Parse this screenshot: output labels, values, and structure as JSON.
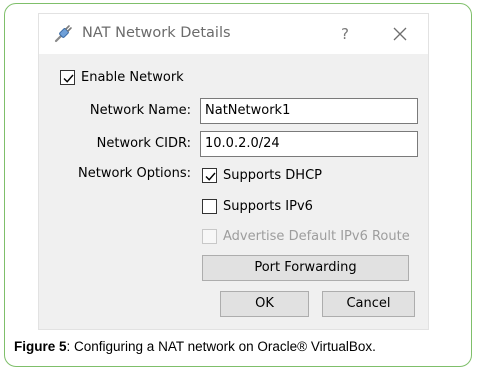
{
  "dialog": {
    "title": "NAT Network Details",
    "help_glyph": "?",
    "icons": {
      "title": "network-cable-icon",
      "close": "close-icon",
      "check": "checkmark-icon"
    }
  },
  "form": {
    "enable_network": {
      "label": "Enable Network",
      "checked": true
    },
    "network_name": {
      "label": "Network Name:",
      "value": "NatNetwork1"
    },
    "network_cidr": {
      "label": "Network CIDR:",
      "value": "10.0.2.0/24"
    },
    "network_options_label": "Network Options:",
    "supports_dhcp": {
      "label": "Supports DHCP",
      "checked": true
    },
    "supports_ipv6": {
      "label": "Supports IPv6",
      "checked": false
    },
    "advertise_ipv6_route": {
      "label": "Advertise Default IPv6 Route",
      "checked": false,
      "enabled": false
    },
    "port_forwarding_label": "Port Forwarding"
  },
  "footer": {
    "ok_label": "OK",
    "cancel_label": "Cancel"
  },
  "caption": {
    "prefix": "Figure 5",
    "text": ": Configuring a NAT network on Oracle® VirtualBox."
  },
  "colors": {
    "frame_border": "#7fbf6a",
    "dialog_bg": "#f0f0f0",
    "button_bg": "#e1e1e1",
    "disabled_text": "#9d9d9d"
  }
}
